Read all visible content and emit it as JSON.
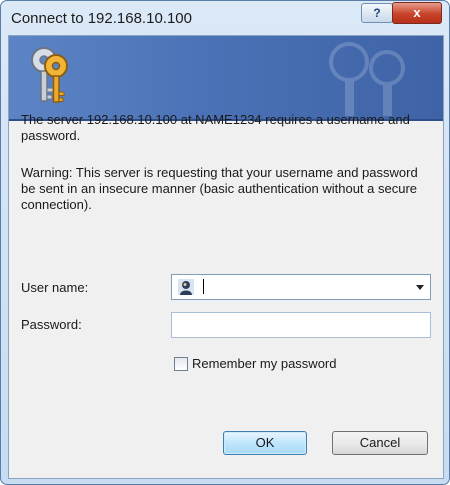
{
  "window": {
    "title": "Connect to 192.168.10.100",
    "help_label": "?",
    "close_label": "x"
  },
  "message": {
    "line1": "The server 192.168.10.100 at NAME1234 requires a username and password.",
    "warning": "Warning: This server is requesting that your username and password be sent in an insecure manner (basic authentication without a secure connection)."
  },
  "form": {
    "username_label": "User name:",
    "username_value": "",
    "password_label": "Password:",
    "password_value": "",
    "remember_label": "Remember my password",
    "remember_checked": false
  },
  "buttons": {
    "ok": "OK",
    "cancel": "Cancel"
  },
  "colors": {
    "banner": "#4b72b6",
    "close": "#c9432b",
    "ok_border": "#3c7fb1"
  },
  "icons": [
    "keys-icon",
    "user-icon",
    "dropdown-arrow-icon"
  ]
}
